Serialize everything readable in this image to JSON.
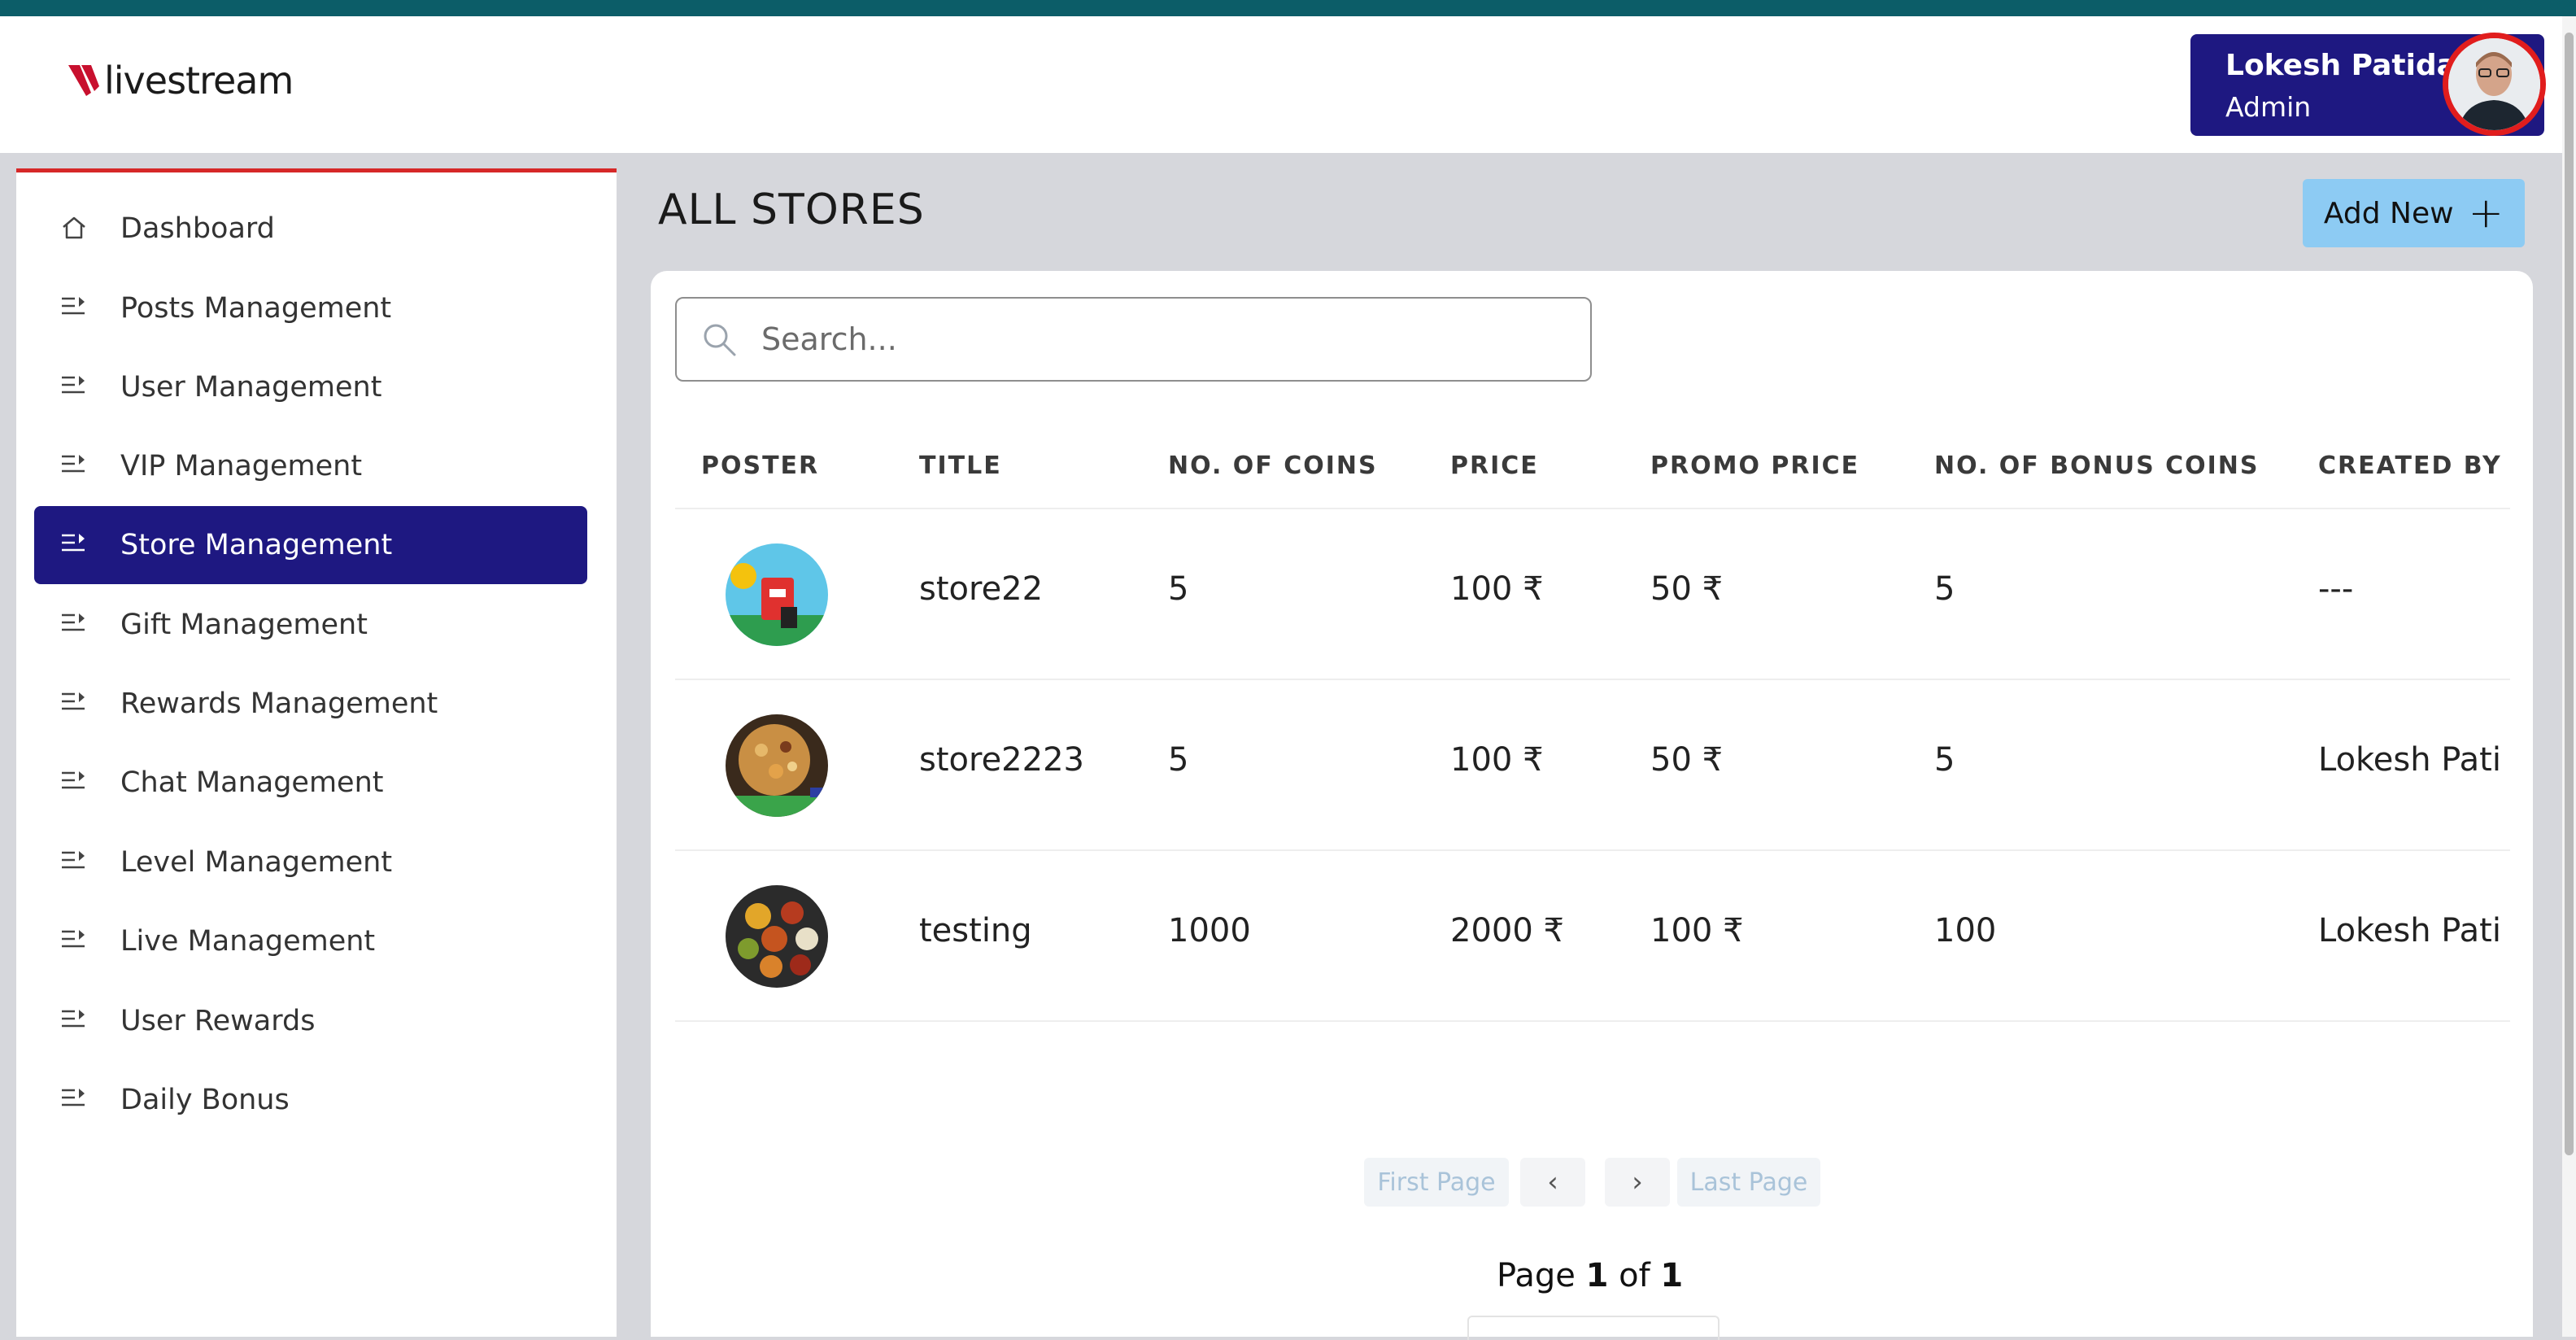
{
  "header": {
    "logo": {
      "text": "livestream"
    },
    "user": {
      "name": "Lokesh Patidar",
      "role": "Admin"
    }
  },
  "sidebar": {
    "items": [
      {
        "label": "Dashboard",
        "icon": "home-icon",
        "active": false
      },
      {
        "label": "Posts Management",
        "icon": "list-arrow-icon",
        "active": false
      },
      {
        "label": "User Management",
        "icon": "list-arrow-icon",
        "active": false
      },
      {
        "label": "VIP Management",
        "icon": "list-arrow-icon",
        "active": false
      },
      {
        "label": "Store Management",
        "icon": "list-arrow-icon",
        "active": true
      },
      {
        "label": "Gift Management",
        "icon": "list-arrow-icon",
        "active": false
      },
      {
        "label": "Rewards Management",
        "icon": "list-arrow-icon",
        "active": false
      },
      {
        "label": "Chat Management",
        "icon": "list-arrow-icon",
        "active": false
      },
      {
        "label": "Level Management",
        "icon": "list-arrow-icon",
        "active": false
      },
      {
        "label": "Live Management",
        "icon": "list-arrow-icon",
        "active": false
      },
      {
        "label": "User Rewards",
        "icon": "list-arrow-icon",
        "active": false
      },
      {
        "label": "Daily Bonus",
        "icon": "list-arrow-icon",
        "active": false
      }
    ]
  },
  "main": {
    "title": "ALL STORES",
    "add_button": "Add New",
    "search": {
      "placeholder": "Search...",
      "value": ""
    },
    "table": {
      "columns": [
        "POSTER",
        "TITLE",
        "NO. OF COINS",
        "PRICE",
        "PROMO PRICE",
        "NO. OF BONUS COINS",
        "CREATED BY"
      ],
      "rows": [
        {
          "poster": "store-poster-image",
          "title": "store22",
          "coins": "5",
          "price": "100 ₹",
          "promo": "50 ₹",
          "bonus": "5",
          "created_by": "---"
        },
        {
          "poster": "food-poster-image",
          "title": "store2223",
          "coins": "5",
          "price": "100 ₹",
          "promo": "50 ₹",
          "bonus": "5",
          "created_by": "Lokesh Pati"
        },
        {
          "poster": "spices-poster-image",
          "title": "testing",
          "coins": "1000",
          "price": "2000 ₹",
          "promo": "100 ₹",
          "bonus": "100",
          "created_by": "Lokesh Pati"
        }
      ]
    },
    "pagination": {
      "first": "First Page",
      "prev": "‹",
      "next": "›",
      "last": "Last Page",
      "page_word": "Page",
      "current": "1",
      "of_word": "of",
      "total": "1"
    }
  },
  "colors": {
    "primary": "#1e1881",
    "accent_red": "#d62828",
    "top_strip": "#0c5d68",
    "add_button": "#8dcbf3"
  }
}
